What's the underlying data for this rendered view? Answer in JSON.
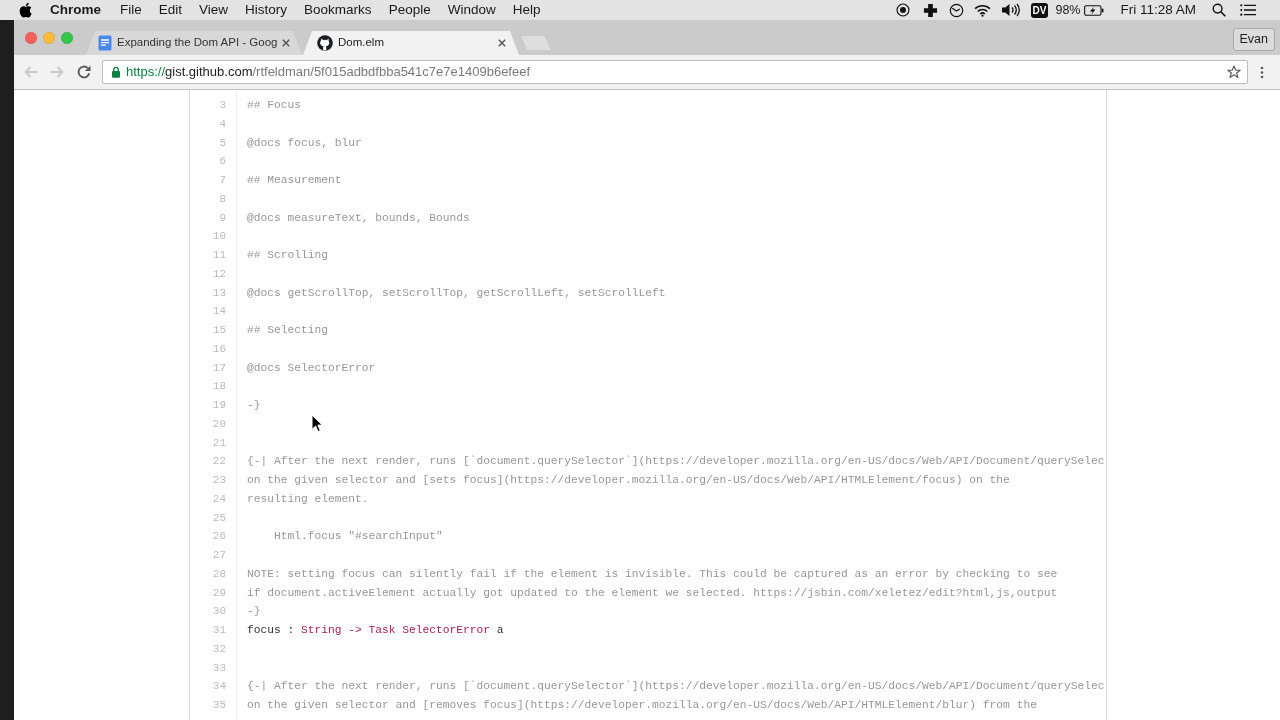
{
  "menu_bar": {
    "app_name": "Chrome",
    "menus": [
      "File",
      "Edit",
      "View",
      "History",
      "Bookmarks",
      "People",
      "Window",
      "Help"
    ],
    "status_badge": "DV",
    "battery": "98%",
    "clock": "Fri 11:28 AM"
  },
  "tabs": [
    {
      "kind": "docs",
      "title": "Expanding the Dom API - Goog",
      "selected": false
    },
    {
      "kind": "github",
      "title": "Dom.elm",
      "selected": true
    }
  ],
  "profile_button": {
    "label": "Evan"
  },
  "toolbar": {
    "back": {
      "disabled": true
    },
    "forward": {
      "disabled": true
    },
    "address": {
      "scheme": "https://",
      "host": "gist.github.com",
      "path": "/rtfeldman/5f015adbdfbba541c7e7e1409b6efeef"
    }
  },
  "code": {
    "lines": [
      {
        "number": "3",
        "tokens": [
          {
            "kind": "comment",
            "text": "## Focus"
          }
        ]
      },
      {
        "number": "4"
      },
      {
        "number": "5",
        "tokens": [
          {
            "kind": "comment",
            "text": "@docs focus, blur"
          }
        ]
      },
      {
        "number": "6"
      },
      {
        "number": "7",
        "tokens": [
          {
            "kind": "comment",
            "text": "## Measurement"
          }
        ]
      },
      {
        "number": "8"
      },
      {
        "number": "9",
        "tokens": [
          {
            "kind": "comment",
            "text": "@docs measureText, bounds, Bounds"
          }
        ]
      },
      {
        "number": "10"
      },
      {
        "number": "11",
        "tokens": [
          {
            "kind": "comment",
            "text": "## Scrolling"
          }
        ]
      },
      {
        "number": "12"
      },
      {
        "number": "13",
        "tokens": [
          {
            "kind": "comment",
            "text": "@docs getScrollTop, setScrollTop, getScrollLeft, setScrollLeft"
          }
        ]
      },
      {
        "number": "14"
      },
      {
        "number": "15",
        "tokens": [
          {
            "kind": "comment",
            "text": "## Selecting"
          }
        ]
      },
      {
        "number": "16"
      },
      {
        "number": "17",
        "tokens": [
          {
            "kind": "comment",
            "text": "@docs SelectorError"
          }
        ]
      },
      {
        "number": "18"
      },
      {
        "number": "19",
        "tokens": [
          {
            "kind": "comment",
            "text": "-}"
          }
        ]
      },
      {
        "number": "20"
      },
      {
        "number": "21"
      },
      {
        "number": "22",
        "tokens": [
          {
            "kind": "comment",
            "text": "{-| After the next render, runs [`document.querySelector`](https://developer.mozilla.org/en-US/docs/Web/API/Document/querySelec"
          }
        ]
      },
      {
        "number": "23",
        "tokens": [
          {
            "kind": "comment",
            "text": "on the given selector and [sets focus](https://developer.mozilla.org/en-US/docs/Web/API/HTMLElement/focus) on the"
          }
        ]
      },
      {
        "number": "24",
        "tokens": [
          {
            "kind": "comment",
            "text": "resulting element."
          }
        ]
      },
      {
        "number": "25"
      },
      {
        "number": "26",
        "tokens": [
          {
            "kind": "comment",
            "text": "    Html.focus \"#searchInput\""
          }
        ]
      },
      {
        "number": "27"
      },
      {
        "number": "28",
        "tokens": [
          {
            "kind": "comment",
            "text": "NOTE: setting focus can silently fail if the element is invisible. This could be captured as an error by checking to see"
          }
        ]
      },
      {
        "number": "29",
        "tokens": [
          {
            "kind": "comment",
            "text": "if document.activeElement actually got updated to the element we selected. https://jsbin.com/xeletez/edit?html,js,output"
          }
        ]
      },
      {
        "number": "30",
        "tokens": [
          {
            "kind": "comment",
            "text": "-}"
          }
        ]
      },
      {
        "number": "31",
        "tokens": [
          {
            "kind": "plain",
            "text": "focus : "
          },
          {
            "kind": "type",
            "text": "String -> Task SelectorError"
          },
          {
            "kind": "plain",
            "text": " a"
          }
        ]
      },
      {
        "number": "32"
      },
      {
        "number": "33"
      },
      {
        "number": "34",
        "tokens": [
          {
            "kind": "comment",
            "text": "{-| After the next render, runs [`document.querySelector`](https://developer.mozilla.org/en-US/docs/Web/API/Document/querySelec"
          }
        ]
      },
      {
        "number": "35",
        "tokens": [
          {
            "kind": "comment",
            "text": "on the given selector and [removes focus](https://developer.mozilla.org/en-US/docs/Web/API/HTMLElement/blur) from the"
          }
        ]
      }
    ]
  }
}
